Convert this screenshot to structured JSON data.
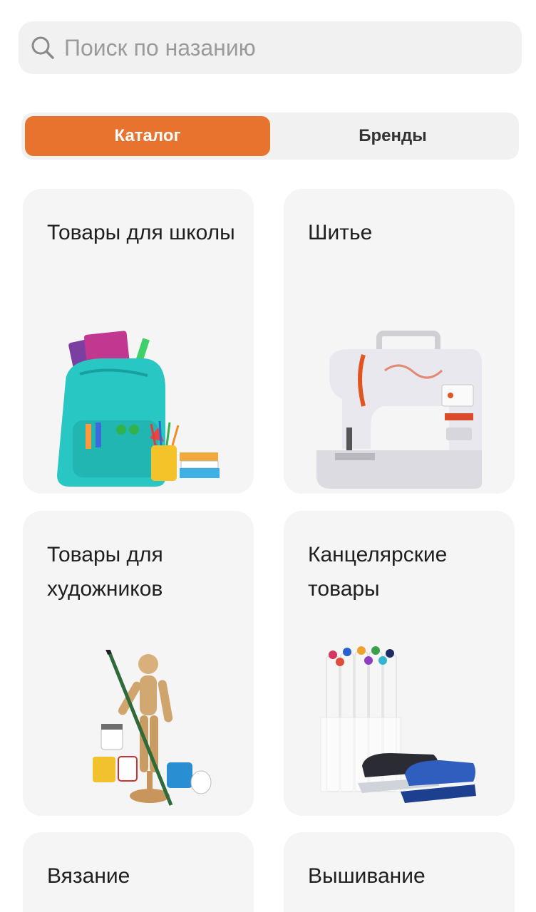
{
  "search": {
    "placeholder": "Поиск по назанию",
    "icon": "search-icon"
  },
  "tabs": {
    "active_label": "Каталог",
    "inactive_label": "Бренды",
    "accent_color": "#e8732e"
  },
  "categories": [
    {
      "label": "Товары для школы",
      "icon": "backpack-image"
    },
    {
      "label": "Шитье",
      "icon": "sewing-machine-image"
    },
    {
      "label": "Товары для художников",
      "icon": "art-supplies-image"
    },
    {
      "label": "Канцелярские товары",
      "icon": "markers-stapler-image"
    },
    {
      "label": "Вязание"
    },
    {
      "label": "Вышивание"
    }
  ]
}
